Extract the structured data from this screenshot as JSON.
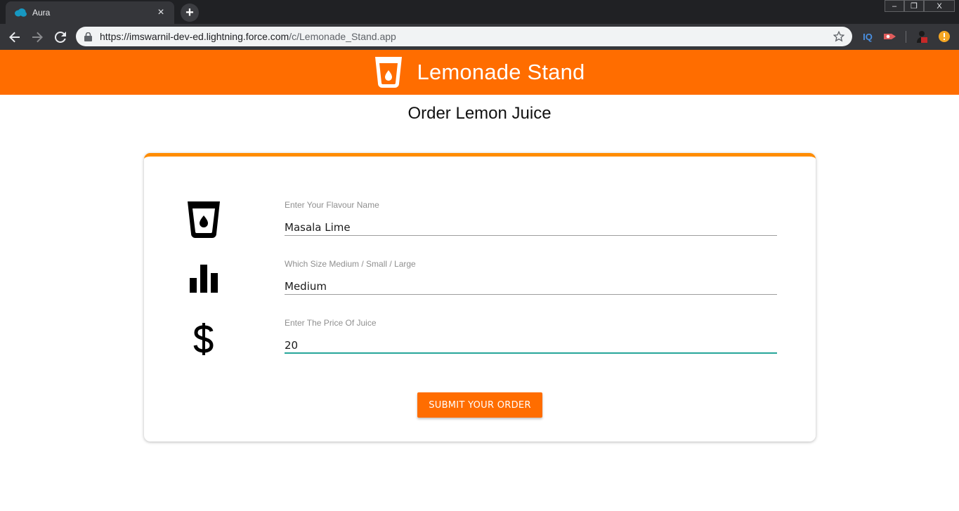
{
  "browser": {
    "tab_title": "Aura",
    "tab_close": "×",
    "new_tab": "+",
    "url_host": "https://imswarnil-dev-ed.lightning.force.com",
    "url_path": "/c/Lemonade_Stand.app",
    "window_controls": {
      "minimize": "–",
      "restore": "❐",
      "close": "X"
    },
    "extensions": [
      {
        "name": "iq-extension-icon",
        "label": "IQ",
        "color": "#4a90e2"
      },
      {
        "name": "record-extension-icon",
        "label": "",
        "color": "#e05c5c"
      },
      {
        "name": "profile-extension-icon",
        "label": "",
        "color": "#c62828"
      },
      {
        "name": "alert-extension-icon",
        "label": "!",
        "color": "#f5a623"
      }
    ]
  },
  "header": {
    "title": "Lemonade Stand",
    "icon": "cup-drop-icon",
    "background": "#ff6d00"
  },
  "page": {
    "title": "Order Lemon Juice"
  },
  "form": {
    "accent": "#ff8c00",
    "fields": [
      {
        "label": "Enter Your Flavour Name",
        "value": "Masala Lime",
        "icon": "cup-drop-icon"
      },
      {
        "label": "Which Size Medium / Small / Large",
        "value": "Medium",
        "icon": "bar-chart-icon"
      },
      {
        "label": "Enter The Price Of Juice",
        "value": "20",
        "icon": "dollar-icon",
        "focused": true
      }
    ],
    "submit_label": "SUBMIT YOUR ORDER",
    "focus_color": "#26a69a"
  }
}
